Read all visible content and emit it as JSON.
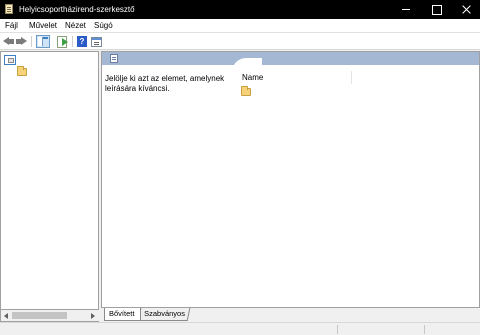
{
  "window": {
    "title": "Helyicsoportházirend-szerkesztő"
  },
  "menu": [
    "Fájl",
    "Művelet",
    "Nézet",
    "Súgó"
  ],
  "toolbar": {
    "help_label": "?"
  },
  "main": {
    "extended_text": "Jelölje ki azt az elemet, amelynek leírására kíváncsi.",
    "column_name": "Name"
  },
  "tabs": [
    "Bővített",
    "Szabványos"
  ]
}
